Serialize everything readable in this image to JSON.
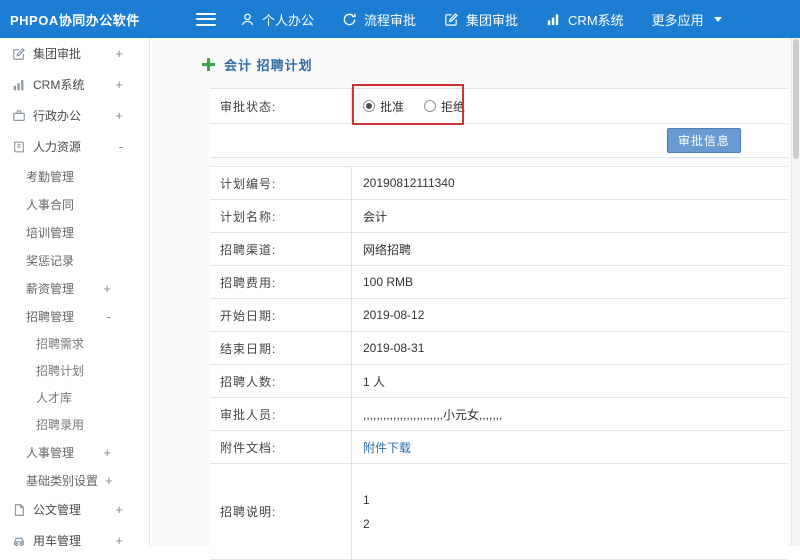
{
  "topbar": {
    "logo": "PHPOA协同办公软件",
    "nav": [
      {
        "label": "个人办公",
        "icon": "person-icon"
      },
      {
        "label": "流程审批",
        "icon": "flow-icon"
      },
      {
        "label": "集团审批",
        "icon": "edit-icon"
      },
      {
        "label": "CRM系统",
        "icon": "chart-icon"
      },
      {
        "label": "更多应用",
        "icon": "caret-down-icon"
      }
    ]
  },
  "sidebar": {
    "items": [
      {
        "label": "集团审批",
        "expander": "+",
        "icon": "edit-icon"
      },
      {
        "label": "CRM系统",
        "expander": "+",
        "icon": "chart-icon"
      },
      {
        "label": "行政办公",
        "expander": "+",
        "icon": "briefcase-icon"
      },
      {
        "label": "人力资源",
        "expander": "-",
        "icon": "book-icon"
      },
      {
        "label": "考勤管理",
        "expander": ""
      },
      {
        "label": "人事合同",
        "expander": ""
      },
      {
        "label": "培训管理",
        "expander": ""
      },
      {
        "label": "奖惩记录",
        "expander": ""
      },
      {
        "label": "薪资管理",
        "expander": "+"
      },
      {
        "label": "招聘管理",
        "expander": "-"
      },
      {
        "label": "招聘需求",
        "expander": ""
      },
      {
        "label": "招聘计划",
        "expander": ""
      },
      {
        "label": "人才库",
        "expander": ""
      },
      {
        "label": "招聘录用",
        "expander": ""
      },
      {
        "label": "人事管理",
        "expander": "+"
      },
      {
        "label": "基础类别设置",
        "expander": "+"
      },
      {
        "label": "公文管理",
        "expander": "+",
        "icon": "document-icon"
      },
      {
        "label": "用车管理",
        "expander": "+",
        "icon": "car-icon"
      }
    ]
  },
  "main": {
    "title": "会计 招聘计划",
    "approval": {
      "label": "审批状态:",
      "options": [
        {
          "label": "批准",
          "checked": true
        },
        {
          "label": "拒绝",
          "checked": false
        }
      ],
      "button": "审批信息"
    },
    "rows": [
      {
        "label": "计划编号:",
        "value": "20190812111340"
      },
      {
        "label": "计划名称:",
        "value": "会计"
      },
      {
        "label": "招聘渠道:",
        "value": "网络招聘"
      },
      {
        "label": "招聘费用:",
        "value": "100 RMB"
      },
      {
        "label": "开始日期:",
        "value": "2019-08-12"
      },
      {
        "label": "结束日期:",
        "value": "2019-08-31"
      },
      {
        "label": "招聘人数:",
        "value": "1 人"
      },
      {
        "label": "审批人员:",
        "value": ",,,,,,,,,,,,,,,,,,,,,,,,小元女,,,,,,,"
      },
      {
        "label": "附件文档:",
        "value": "附件下载"
      },
      {
        "label": "招聘说明:",
        "value": "1\n2"
      }
    ]
  },
  "colors": {
    "topbar": "#1b7ed3",
    "title": "#2e6da4",
    "plus": "#3aa64a",
    "button": "#699bd2",
    "link": "#2e6fad",
    "annotation": "#cc3333"
  }
}
